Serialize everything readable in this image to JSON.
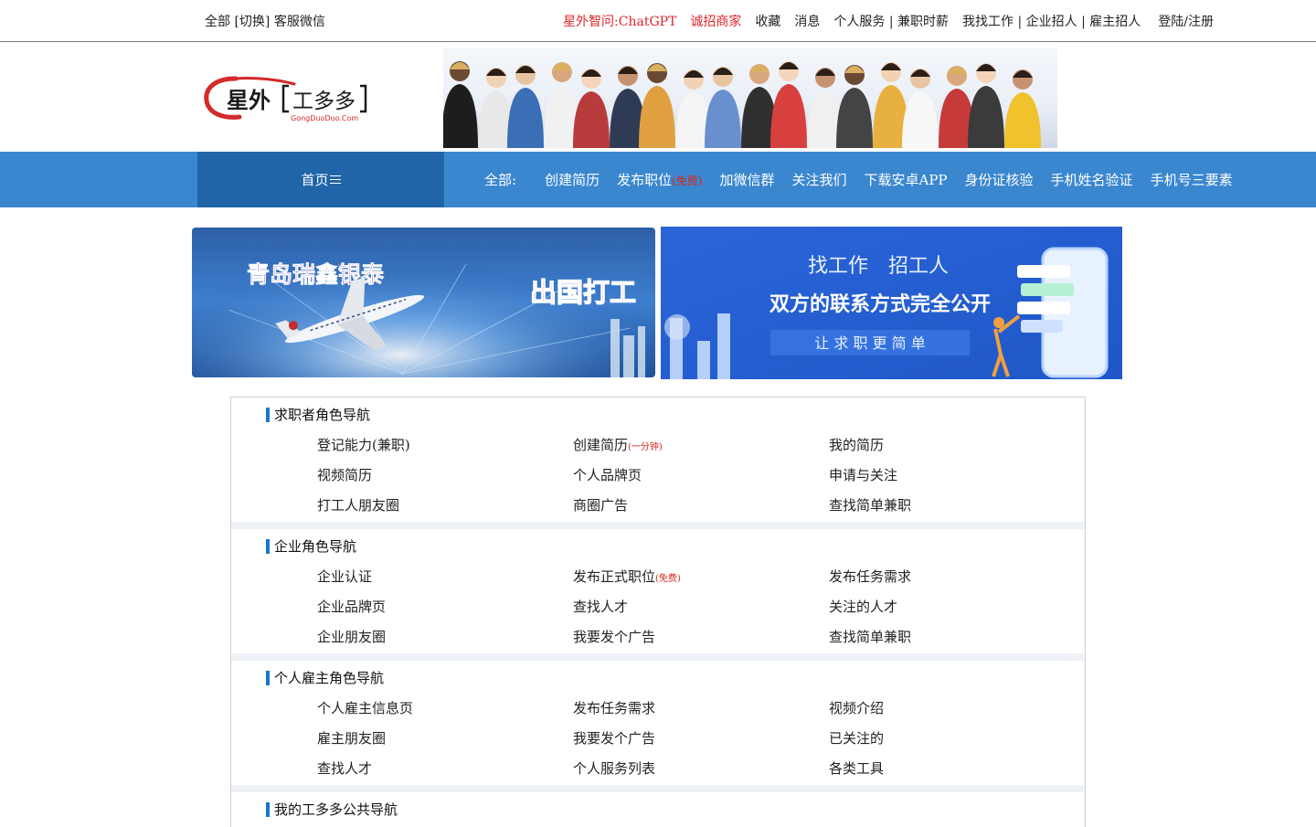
{
  "topbar": {
    "left": "全部 [切换] 客服微信",
    "links": {
      "chatgpt": "星外智问:ChatGPT",
      "merchants": "诚招商家",
      "favorites": "收藏",
      "messages": "消息",
      "personal_service": "个人服务 | 兼职时薪",
      "find_job": "我找工作 | 企业招人 | 雇主招人",
      "login": "登陆/注册"
    }
  },
  "logo": {
    "main": "星外",
    "bracket_text": "工多多",
    "sub": "GongDuoDuo.Com"
  },
  "nav": {
    "home": "首页",
    "label": "全部:",
    "items": {
      "create_resume": "创建简历",
      "post_job": "发布职位",
      "post_job_free": "(免费)",
      "wechat_group": "加微信群",
      "follow": "关注我们",
      "android": "下载安卓APP",
      "id_verify": "身份证核验",
      "phone_name": "手机姓名验证",
      "phone_three": "手机号三要素"
    }
  },
  "ads": {
    "ad1": {
      "company": "青岛瑞鑫银泰",
      "slogan": "出国打工"
    },
    "ad2": {
      "line1": "找工作　招工人",
      "line2": "双方的联系方式完全公开",
      "line3": "让 求 职 更 简 单"
    }
  },
  "sections": [
    {
      "title": "求职者角色导航",
      "items": [
        {
          "label": "登记能力(兼职)"
        },
        {
          "label": "创建简历",
          "note": "(一分钟)"
        },
        {
          "label": "我的简历"
        },
        {
          "label": "视频简历"
        },
        {
          "label": "个人品牌页"
        },
        {
          "label": "申请与关注"
        },
        {
          "label": "打工人朋友圈"
        },
        {
          "label": "商圈广告"
        },
        {
          "label": "查找简单兼职"
        }
      ]
    },
    {
      "title": "企业角色导航",
      "items": [
        {
          "label": "企业认证"
        },
        {
          "label": "发布正式职位",
          "note": "(免费)"
        },
        {
          "label": "发布任务需求"
        },
        {
          "label": "企业品牌页"
        },
        {
          "label": "查找人才"
        },
        {
          "label": "关注的人才"
        },
        {
          "label": "企业朋友圈"
        },
        {
          "label": "我要发个广告"
        },
        {
          "label": "查找简单兼职"
        }
      ]
    },
    {
      "title": "个人雇主角色导航",
      "items": [
        {
          "label": "个人雇主信息页"
        },
        {
          "label": "发布任务需求"
        },
        {
          "label": "视频介绍"
        },
        {
          "label": "雇主朋友圈"
        },
        {
          "label": "我要发个广告"
        },
        {
          "label": "已关注的"
        },
        {
          "label": "查找人才"
        },
        {
          "label": "个人服务列表"
        },
        {
          "label": "各类工具"
        }
      ]
    },
    {
      "title": "我的工多多公共导航",
      "items": []
    }
  ],
  "colors": {
    "nav_bg": "#3b87cf",
    "nav_home_bg": "#1f65a8",
    "accent_red": "#e0242a",
    "section_bar": "#1a75d2"
  }
}
